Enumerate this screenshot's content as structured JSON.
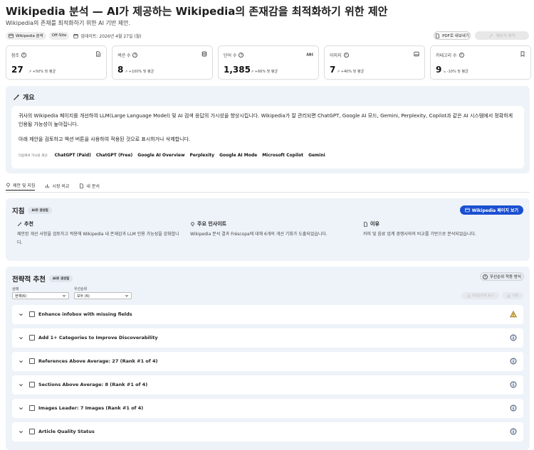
{
  "header": {
    "title": "Wikipedia 분석 — AI가 제공하는 Wikipedia의 존재감을 최적화하기 위한 제안",
    "subtitle": "Wikipedia의 존재를 최적화하기 위한 AI 기반 제안.",
    "tags": [
      "Wikipedia 분석",
      "Off-Site"
    ],
    "updated": "업데이트: 2026년 4월 27일 (월)",
    "pdf_button": "PDF로 내보내기",
    "reanalyze_button": "재분석 예약"
  },
  "stats": [
    {
      "label": "참조",
      "value": "27",
      "change": "↗ +50% 및 평균"
    },
    {
      "label": "섹션 수",
      "value": "8",
      "change": "↗ +100% 및 평균"
    },
    {
      "label": "단어 수",
      "value": "1,385",
      "change": "↗ +66% 및 평균"
    },
    {
      "label": "이미지",
      "value": "7",
      "change": "↗ +40% 및 평균"
    },
    {
      "label": "카테고리 수",
      "value": "9",
      "change": "↘ -10% 및 평균"
    }
  ],
  "overview": {
    "title": "개요",
    "paragraph1": "귀사의 Wikipedia 페이지를 개선하여 LLM(Large Language Model) 및 AI 검색 응답의 가시성을 향상시킵니다. Wikipedia가 잘 관리되면 ChatGPT, Google AI 모드, Gemini, Perplexity, Copilot과 같은 AI 시스템에서 정확하게 인용될 가능성이 높아집니다.",
    "paragraph2": "아래 제안을 검토하고 액션 버튼을 사용하여 적용된 것으로 표시하거나 삭제합니다.",
    "services_lead": "다음에서 가시성 개선:",
    "services": [
      "ChatGPT (Paid)",
      "ChatGPT (Free)",
      "Google AI Overview",
      "Perplexity",
      "Google AI Mode",
      "Microsoft Copilot",
      "Gemini"
    ]
  },
  "tabs": [
    {
      "label": "제안 및 지침"
    },
    {
      "label": "시장 비교"
    },
    {
      "label": "내 문서"
    }
  ],
  "guidelines": {
    "title": "지침",
    "badge": "AI로 생성됨",
    "view_button": "Wikipedia 페이지 보기",
    "columns": [
      {
        "heading": "추천",
        "text": "제안된 개선 사항을 검토하고 적용해 Wikipedia 내 존재감과 LLM 인용 가능성을 강화합니다."
      },
      {
        "heading": "주요 인사이트",
        "text": "Wikipedia 분석 결과 Fréscopa에 대해 6개의 개선 기회가 도출되었습니다."
      },
      {
        "heading": "이유",
        "text": "커피 및 음료 업계 경쟁사와의 비교를 기반으로 분석되었습니다."
      }
    ]
  },
  "strategy": {
    "title": "전략적 추천",
    "badge": "AI로 생성됨",
    "priority_button": "우선순위 작동 방식",
    "status_label": "상태",
    "status_value": "현재(6)",
    "priority_label": "우선순위",
    "priority_value": "모두 (6)",
    "apply_button": "적용됨으로 표시",
    "delete_button": "삭제",
    "items": [
      {
        "title": "Enhance infobox with missing fields",
        "icon": "warning-icon"
      },
      {
        "title": "Add 1+ Categories to Improve Discoverability",
        "icon": "info-icon"
      },
      {
        "title": "References Above Average: 27 (Rank #1 of 4)",
        "icon": "info-icon"
      },
      {
        "title": "Sections Above Average: 8 (Rank #1 of 4)",
        "icon": "info-icon"
      },
      {
        "title": "Images Leader: 7 Images (Rank #1 of 4)",
        "icon": "info-icon"
      },
      {
        "title": "Article Quality Status",
        "icon": "info-icon"
      }
    ]
  }
}
